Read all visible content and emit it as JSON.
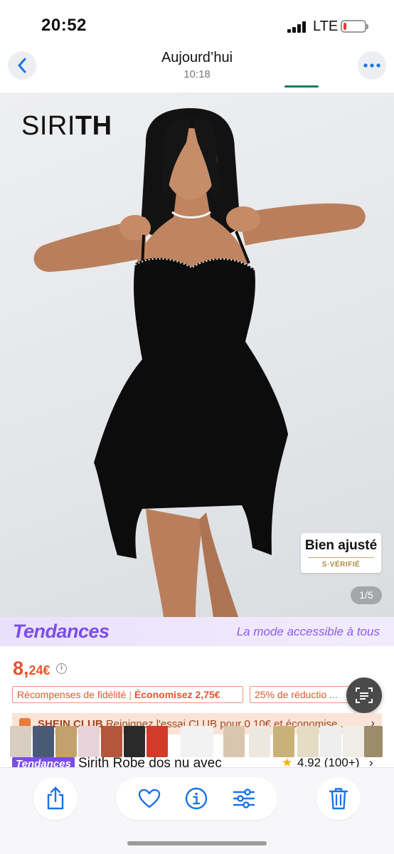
{
  "status_bar": {
    "time": "20:52",
    "network": "LTE",
    "battery_level": 0.15,
    "battery_color": "#e53935"
  },
  "nav": {
    "title": "Aujourd’hui",
    "subtitle": "10:18",
    "back_icon": "chevron-left-icon",
    "more_icon": "ellipsis-icon",
    "accent": "#1a73e8"
  },
  "photo": {
    "brand_light": "SIRI",
    "brand_bold": "TH",
    "fit_badge_title": "Bien ajusté",
    "fit_badge_sub": "S·VÉRIFIÉ",
    "page_counter": "1/5"
  },
  "trends_banner": {
    "logo": "Tendances",
    "tagline": "La mode accessible à tous"
  },
  "price": {
    "integer": "8,",
    "decimal": "24€",
    "color": "#e8542c"
  },
  "promos": {
    "loyalty": "Récompenses de fidélité",
    "savings": "Économisez 2,75€",
    "discount": "25% de réductio ..."
  },
  "club": {
    "name": "SHEIN CLUB",
    "text": "Rejoignez l'essai CLUB pour 0,10€ et économise..."
  },
  "product": {
    "tag": "Tendances",
    "title": "Sirith Robe dos nu avec",
    "rating": "4.92 (100+)"
  },
  "toolbar": {
    "share_icon": "share-icon",
    "favorite_icon": "heart-icon",
    "info_icon": "info-icon",
    "adjust_icon": "sliders-icon",
    "delete_icon": "trash-icon",
    "icon_color": "#1a73e8"
  }
}
